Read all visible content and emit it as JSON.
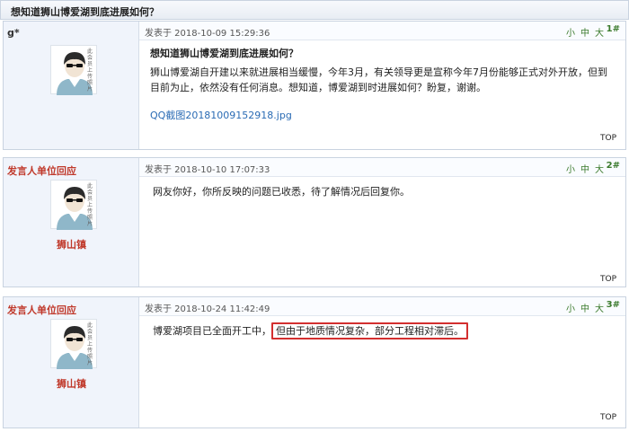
{
  "thread": {
    "title": "想知道狮山博爱湖到底进展如何？"
  },
  "ui": {
    "font_sizes": [
      "小",
      "中",
      "大"
    ],
    "top_label": "TOP"
  },
  "colors": {
    "official": "#c0392b",
    "meta_green": "#3a7a2c",
    "highlight": "#d32f2f",
    "link": "#2a6bb4"
  },
  "avatar": {
    "caption": "此会员上传照片",
    "icon": "default-user-avatar-icon"
  },
  "posts": [
    {
      "author": "g*",
      "posted_at": "发表于 2018-10-09 15:29:36",
      "floor": "1#",
      "heading": "想知道狮山博爱湖到底进展如何？",
      "body": "狮山博爱湖自开建以来就进展相当缓慢，今年3月，有关领导更是宣称今年7月份能够正式对外开放，但到目前为止，依然没有任何消息。想知道，博爱湖到时进展如何？盼复，谢谢。",
      "attachment": "QQ截图20181009152918.jpg"
    },
    {
      "author": "发言人单位回应",
      "author_sub": "狮山镇",
      "posted_at": "发表于 2018-10-10 17:07:33",
      "floor": "2#",
      "body": "网友你好，你所反映的问题已收悉，待了解情况后回复你。"
    },
    {
      "author": "发言人单位回应",
      "author_sub": "狮山镇",
      "posted_at": "发表于 2018-10-24 11:42:49",
      "floor": "3#",
      "body_plain": "博爱湖项目已全面开工中，",
      "body_highlight": "但由于地质情况复杂，部分工程相对滞后。"
    }
  ]
}
